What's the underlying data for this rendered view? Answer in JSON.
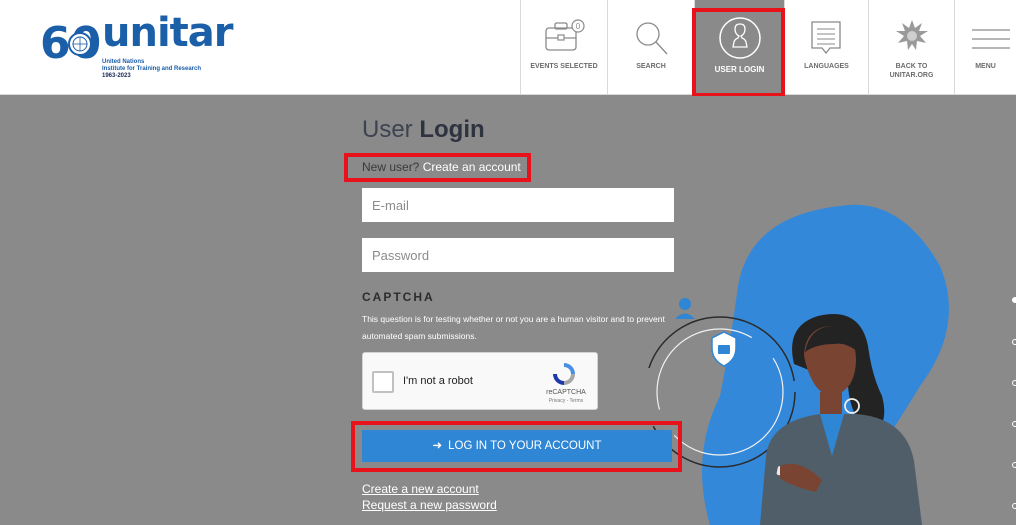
{
  "logo": {
    "mark": "60",
    "name": "unitar",
    "line1": "United Nations",
    "line2": "Institute for Training and Research",
    "years": "1963-2023"
  },
  "nav": {
    "events": {
      "label": "EVENTS SELECTED",
      "count": "0"
    },
    "search": {
      "label": "SEARCH"
    },
    "login": {
      "label": "USER LOGIN"
    },
    "languages": {
      "label": "LANGUAGES"
    },
    "back": {
      "label_line1": "BACK TO",
      "label_line2": "UNITAR.ORG"
    },
    "menu": {
      "label": "MENU"
    }
  },
  "form": {
    "title_light": "User ",
    "title_bold": "Login",
    "new_user_text": "New user? ",
    "create_account_link": "Create an account",
    "email_placeholder": "E-mail",
    "password_placeholder": "Password",
    "captcha_heading": "CAPTCHA",
    "captcha_description": "This question is for testing whether or not you are a human visitor and to prevent automated spam submissions.",
    "recaptcha_label": "I'm not a robot",
    "recaptcha_brand": "reCAPTCHA",
    "recaptcha_links": "Privacy - Terms",
    "submit_label": "LOG IN TO YOUR ACCOUNT",
    "link_create": "Create a new account",
    "link_reset": "Request a new password"
  },
  "colors": {
    "accent": "#2f86d5",
    "brand": "#1a5fa8",
    "highlight": "#e8131a",
    "background": "#8a8a8a"
  }
}
